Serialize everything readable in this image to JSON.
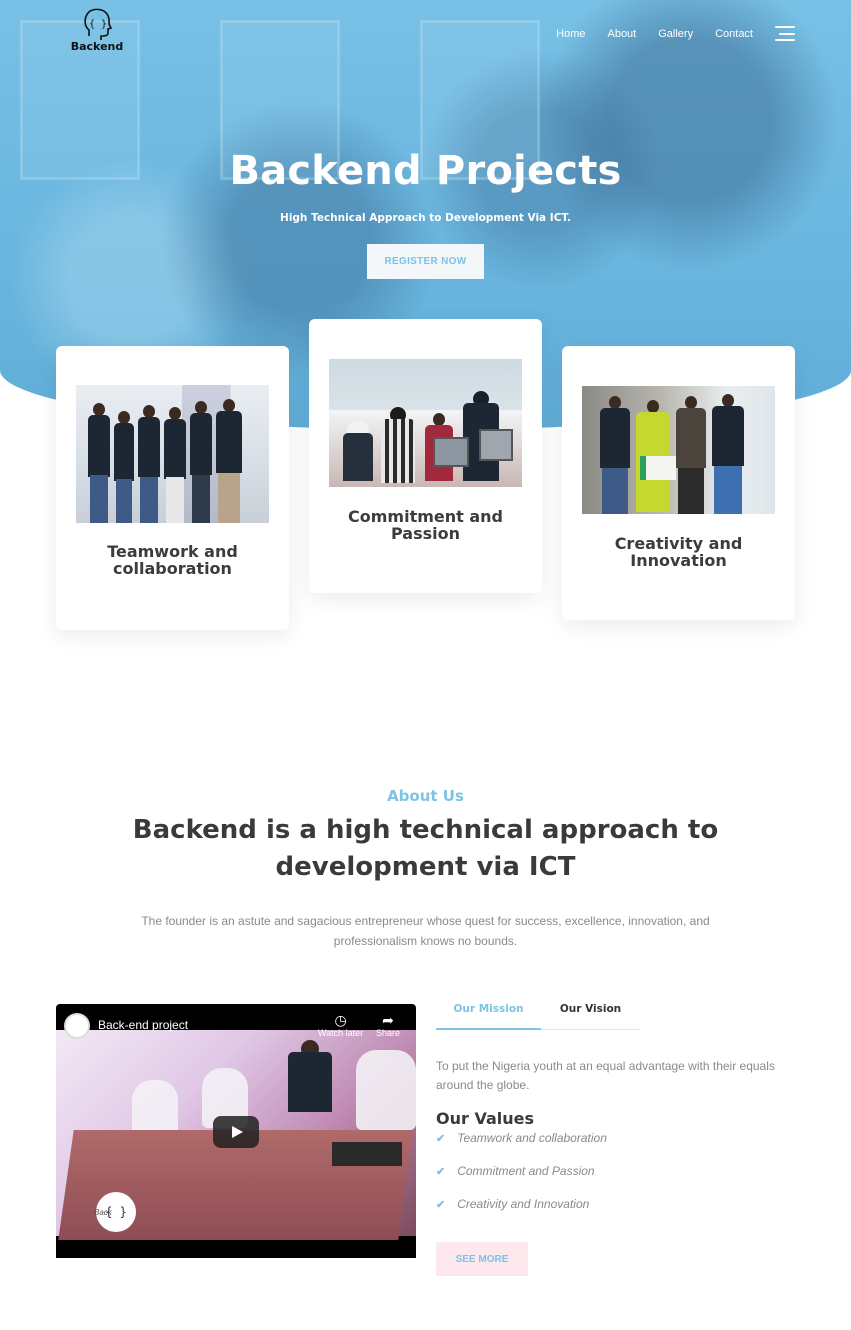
{
  "brand": {
    "logo_text": "Backend"
  },
  "nav": {
    "items": [
      {
        "label": "Home"
      },
      {
        "label": "About"
      },
      {
        "label": "Gallery"
      },
      {
        "label": "Contact"
      }
    ]
  },
  "hero": {
    "title": "Backend Projects",
    "subtitle": "High Technical Approach to Development Via ICT.",
    "cta_label": "REGISTER NOW"
  },
  "features": [
    {
      "title": "Teamwork and collaboration"
    },
    {
      "title": "Commitment and Passion"
    },
    {
      "title": "Creativity and Innovation"
    }
  ],
  "about": {
    "kicker": "About Us",
    "title": "Backend is a high technical approach to development via ICT",
    "description": "The founder is an astute and sagacious entrepreneur whose quest for success, excellence, innovation, and professionalism knows no bounds."
  },
  "video": {
    "title": "Back-end project",
    "watch_later": "Watch later",
    "share": "Share",
    "watermark": "Back"
  },
  "tabs": {
    "mission_label": "Our Mission",
    "vision_label": "Our Vision",
    "mission_text": "To put the Nigeria youth at an equal advantage with their equals around the globe."
  },
  "values": {
    "title": "Our Values",
    "items": [
      {
        "label": "Teamwork and collaboration"
      },
      {
        "label": "Commitment and Passion"
      },
      {
        "label": "Creativity and Innovation"
      }
    ]
  },
  "see_more_label": "SEE MORE",
  "colors": {
    "accent": "#7cc3e4",
    "heading": "#3a3a3a",
    "body_text": "#8a8a8a",
    "see_more_bg": "#fde8ee"
  }
}
